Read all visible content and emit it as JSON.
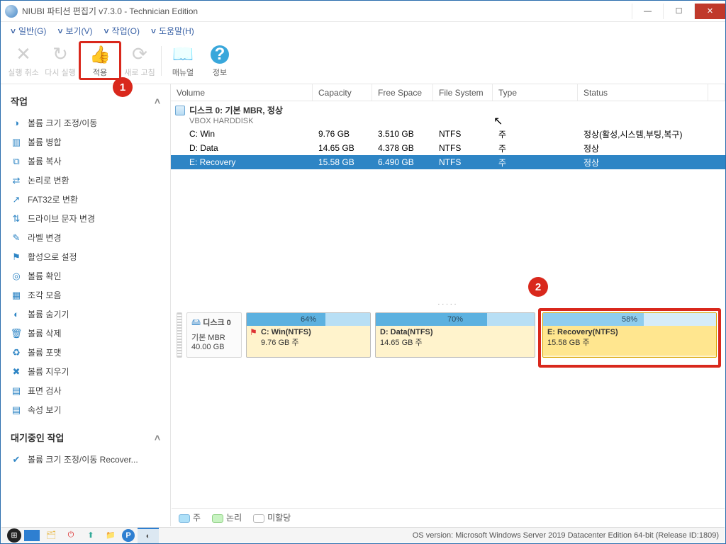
{
  "window": {
    "title": "NIUBI 파티션 편집기 v7.3.0 - Technician Edition"
  },
  "menu": {
    "general": "일반(G)",
    "view": "보기(V)",
    "action": "작업(O)",
    "help": "도움말(H)"
  },
  "toolbar": {
    "undo": "실행 취소",
    "redo": "다시 실행",
    "apply": "적용",
    "refresh": "새로 고침",
    "manual": "매뉴얼",
    "info": "정보"
  },
  "callouts": {
    "one": "1",
    "two": "2"
  },
  "sidebar": {
    "section_ops": "작업",
    "items": [
      "볼륨 크기 조정/이동",
      "볼륨 병합",
      "볼륨 복사",
      "논리로 변환",
      "FAT32로 변환",
      "드라이브 문자 변경",
      "라벨 변경",
      "활성으로 설정",
      "볼륨 확인",
      "조각 모음",
      "볼륨 숨기기",
      "볼륨 삭제",
      "볼륨 포맷",
      "볼륨 지우기",
      "표면 검사",
      "속성 보기"
    ],
    "section_pending": "대기중인 작업",
    "pending": [
      "볼륨 크기 조정/이동 Recover..."
    ]
  },
  "columns": {
    "volume": "Volume",
    "capacity": "Capacity",
    "free": "Free Space",
    "fs": "File System",
    "type": "Type",
    "status": "Status"
  },
  "disk_header": {
    "title": "디스크 0: 기본 MBR, 정상",
    "sub": "VBOX HARDDISK"
  },
  "rows": [
    {
      "vol": "C: Win",
      "cap": "9.76 GB",
      "free": "3.510 GB",
      "fs": "NTFS",
      "type": "주",
      "status": "정상(활성,시스템,부팅,복구)"
    },
    {
      "vol": "D: Data",
      "cap": "14.65 GB",
      "free": "4.378 GB",
      "fs": "NTFS",
      "type": "주",
      "status": "정상"
    },
    {
      "vol": "E: Recovery",
      "cap": "15.58 GB",
      "free": "6.490 GB",
      "fs": "NTFS",
      "type": "주",
      "status": "정상"
    }
  ],
  "diskmap": {
    "disk_label": "디스크 0",
    "disk_type": "기본 MBR",
    "disk_size": "40.00 GB",
    "parts": [
      {
        "pct": "64%",
        "title": "C: Win(NTFS)",
        "sub": "9.76 GB 주",
        "flag": true
      },
      {
        "pct": "70%",
        "title": "D: Data(NTFS)",
        "sub": "14.65 GB 주"
      },
      {
        "pct": "58%",
        "title": "E: Recovery(NTFS)",
        "sub": "15.58 GB 주"
      }
    ]
  },
  "legend": {
    "primary": "주",
    "logical": "논리",
    "unalloc": "미할당"
  },
  "statusbar": {
    "os": "OS version: Microsoft Windows Server 2019 Datacenter Edition  64-bit  (Release ID:1809)"
  }
}
